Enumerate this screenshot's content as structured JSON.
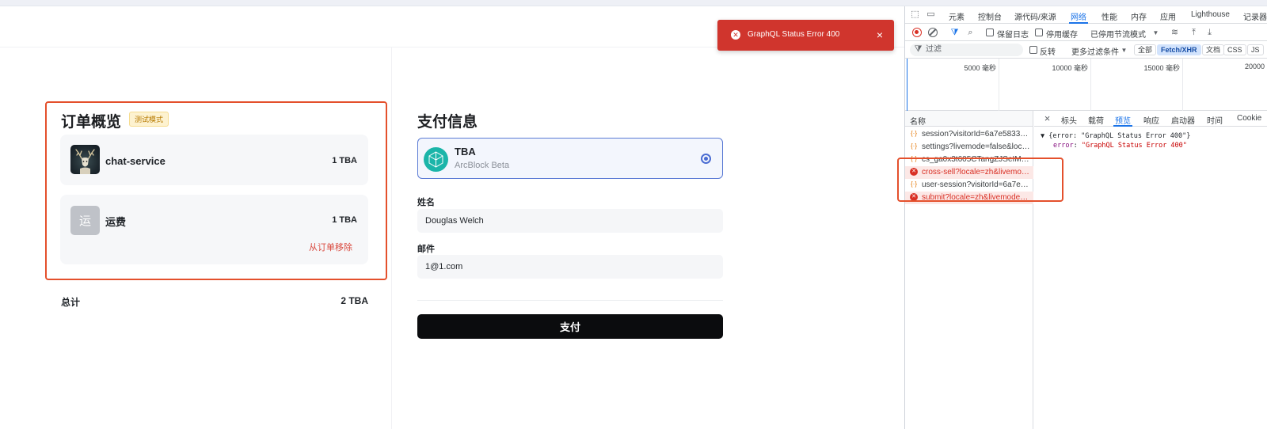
{
  "toast": {
    "message": "GraphQL Status Error 400",
    "close_symbol": "×",
    "icon": "error-circle-icon"
  },
  "order": {
    "title": "订单概览",
    "badge": "测试模式",
    "items": [
      {
        "name": "chat-service",
        "price": "1 TBA",
        "thumb": "deer-logo-image"
      },
      {
        "name": "运费",
        "price": "1 TBA",
        "thumb_char": "运",
        "remove_label": "从订单移除"
      }
    ],
    "total_label": "总计",
    "total_value": "2 TBA"
  },
  "payment": {
    "title": "支付信息",
    "method": {
      "name": "TBA",
      "sub": "ArcBlock Beta"
    },
    "name_label": "姓名",
    "name_value": "Douglas Welch",
    "email_label": "邮件",
    "email_value": "1@1.com",
    "pay_label": "支付"
  },
  "devtools": {
    "tabs": [
      "元素",
      "控制台",
      "源代码/来源",
      "网络",
      "性能",
      "内存",
      "应用",
      "Lighthouse",
      "记录器"
    ],
    "active_tab": "网络",
    "toolbar": {
      "preserve_log": "保留日志",
      "disable_cache": "停用缓存",
      "throttle": "已停用节流模式"
    },
    "filter": {
      "placeholder": "过滤",
      "invert": "反转",
      "more_filters": "更多过滤条件",
      "chips": [
        "全部",
        "Fetch/XHR",
        "文档",
        "CSS",
        "JS"
      ],
      "active_chip": "Fetch/XHR"
    },
    "timeline_ticks": [
      "5000 毫秒",
      "10000 毫秒",
      "15000 毫秒",
      "20000"
    ],
    "name_header": "名称",
    "requests": [
      {
        "url": "session?visitorId=6a7e5833-9f…",
        "status": "ok"
      },
      {
        "url": "settings?livemode=false&local…",
        "status": "ok"
      },
      {
        "url": "cs_ga0x3t605CTangZJSeIMD…",
        "status": "ok"
      },
      {
        "url": "cross-sell?locale=zh&livemode…",
        "status": "error"
      },
      {
        "url": "user-session?visitorId=6a7e58…",
        "status": "ok"
      },
      {
        "url": "submit?locale=zh&livemode=fa…",
        "status": "error"
      }
    ],
    "detail_tabs": [
      "标头",
      "载荷",
      "预览",
      "响应",
      "启动器",
      "时间",
      "Cookie"
    ],
    "active_detail_tab": "预览",
    "preview": {
      "summary": "▼ {error: \"GraphQL Status Error 400\"}",
      "key": "error",
      "value": "\"GraphQL Status Error 400\""
    }
  },
  "colors": {
    "error": "#d0352d",
    "highlight": "#e4502c",
    "accent": "#1a73e8",
    "pay_button": "#0b0c0e"
  }
}
